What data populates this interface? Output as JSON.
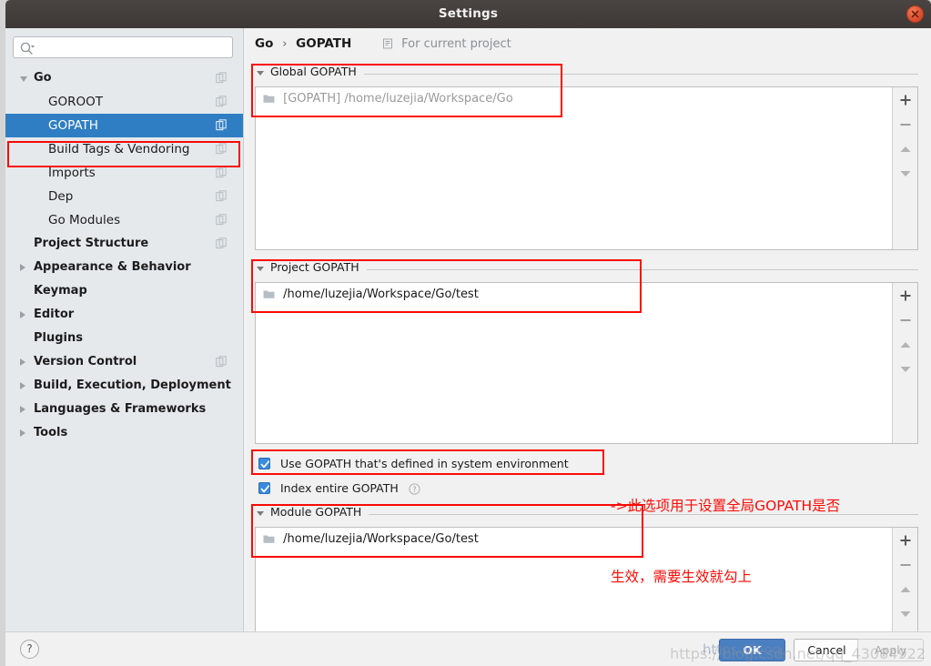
{
  "window": {
    "title": "Settings",
    "close_label": "x"
  },
  "search": {
    "placeholder": "",
    "value": "",
    "icon": "search-icon"
  },
  "sidebar": {
    "items": [
      {
        "label": "Go",
        "level": 0,
        "arrow": "expanded",
        "copy_icon": true,
        "selected": false
      },
      {
        "label": "GOROOT",
        "level": 1,
        "arrow": "none",
        "copy_icon": true,
        "selected": false
      },
      {
        "label": "GOPATH",
        "level": 1,
        "arrow": "none",
        "copy_icon": true,
        "selected": true
      },
      {
        "label": "Build Tags & Vendoring",
        "level": 1,
        "arrow": "none",
        "copy_icon": true,
        "selected": false
      },
      {
        "label": "Imports",
        "level": 1,
        "arrow": "none",
        "copy_icon": true,
        "selected": false
      },
      {
        "label": "Dep",
        "level": 1,
        "arrow": "none",
        "copy_icon": true,
        "selected": false
      },
      {
        "label": "Go Modules",
        "level": 1,
        "arrow": "none",
        "copy_icon": true,
        "selected": false
      },
      {
        "label": "Project Structure",
        "level": 0,
        "arrow": "none",
        "copy_icon": true,
        "selected": false
      },
      {
        "label": "Appearance & Behavior",
        "level": 0,
        "arrow": "collapsed",
        "copy_icon": false,
        "selected": false
      },
      {
        "label": "Keymap",
        "level": 0,
        "arrow": "none",
        "copy_icon": false,
        "selected": false
      },
      {
        "label": "Editor",
        "level": 0,
        "arrow": "collapsed",
        "copy_icon": false,
        "selected": false
      },
      {
        "label": "Plugins",
        "level": 0,
        "arrow": "none",
        "copy_icon": false,
        "selected": false
      },
      {
        "label": "Version Control",
        "level": 0,
        "arrow": "collapsed",
        "copy_icon": true,
        "selected": false
      },
      {
        "label": "Build, Execution, Deployment",
        "level": 0,
        "arrow": "collapsed",
        "copy_icon": false,
        "selected": false
      },
      {
        "label": "Languages & Frameworks",
        "level": 0,
        "arrow": "collapsed",
        "copy_icon": false,
        "selected": false
      },
      {
        "label": "Tools",
        "level": 0,
        "arrow": "collapsed",
        "copy_icon": false,
        "selected": false
      }
    ]
  },
  "header": {
    "crumb_root": "Go",
    "crumb_sep": "›",
    "crumb_current": "GOPATH",
    "scope_label": "For current project"
  },
  "sections": {
    "global": {
      "title": "Global GOPATH",
      "items": [
        {
          "text": "[GOPATH] /home/luzejia/Workspace/Go",
          "muted": true
        }
      ]
    },
    "project": {
      "title": "Project GOPATH",
      "items": [
        {
          "text": "/home/luzejia/Workspace/Go/test",
          "muted": false
        }
      ]
    },
    "module": {
      "title": "Module GOPATH",
      "items": [
        {
          "text": "/home/luzejia/Workspace/Go/test",
          "muted": false
        }
      ]
    }
  },
  "toolbar": {
    "add_label": "+",
    "remove_label": "−",
    "up_label": "up-arrow",
    "down_label": "down-arrow"
  },
  "checkboxes": [
    {
      "label": "Use GOPATH that's defined in system environment",
      "checked": true,
      "help": false
    },
    {
      "label": "Index entire GOPATH",
      "checked": true,
      "help": true
    }
  ],
  "annotation": {
    "line1": "->此选项用于设置全局GOPATH是否",
    "line2": "生效，需要生效就勾上",
    "color": "#fb0b06"
  },
  "footer": {
    "help_label": "?",
    "ok_label": "OK",
    "cancel_label": "Cancel",
    "apply_label": "Apply"
  },
  "watermark": {
    "text": "https://blog.csdn.net/qq_43084922",
    "left_text": "https://blog."
  },
  "colors": {
    "selection": "#2f7ec4",
    "highlight": "#fb0b06",
    "titlebar": "#3d3835",
    "panel": "#e5e9ec"
  }
}
